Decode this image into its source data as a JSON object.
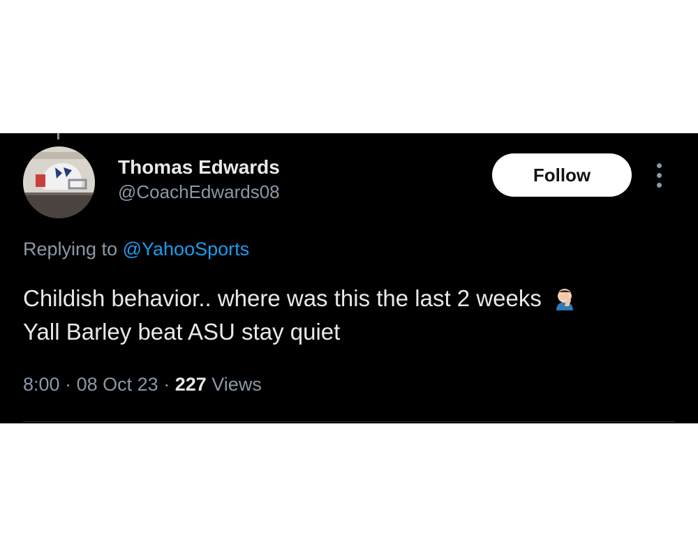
{
  "tweet": {
    "author_name": "Thomas Edwards",
    "author_handle": "@CoachEdwards08",
    "follow_label": "Follow",
    "replying_prefix": "Replying to",
    "replying_handle": "@YahooSports",
    "text_line1": "Childish behavior.. where was this the last 2 weeks",
    "text_line2": "Yall Barley beat ASU stay quiet",
    "emoji": "face-palm-emoji",
    "time": "8:00",
    "date": "08 Oct 23",
    "views_count": "227",
    "views_label": "Views",
    "separator": "·"
  },
  "icons": {
    "more": "more-vertical-icon",
    "avatar": "football-helmet-avatar"
  },
  "colors": {
    "background": "#000000",
    "text": "#e7e9ea",
    "muted": "#8b98a5",
    "link": "#1d9bf0",
    "follow_bg": "#ffffff"
  }
}
